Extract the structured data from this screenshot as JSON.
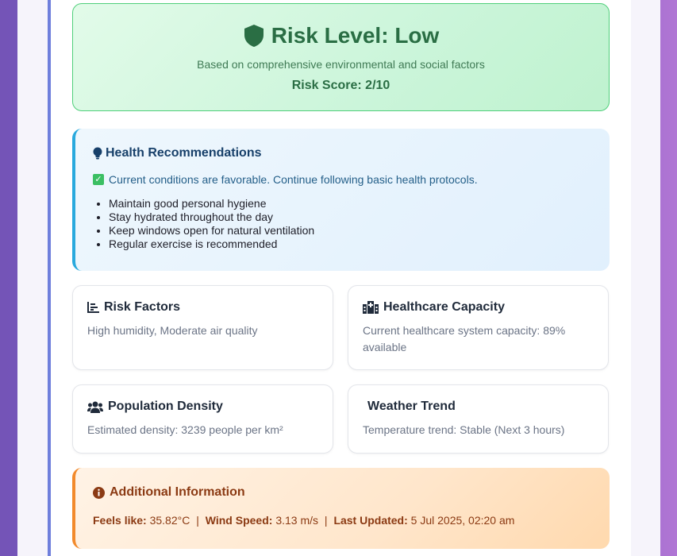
{
  "risk": {
    "title": "Risk Level: Low",
    "subtitle": "Based on comprehensive environmental and social factors",
    "score": "Risk Score: 2/10",
    "icon": "shield-icon"
  },
  "health": {
    "title": "Health Recommendations",
    "note": "Current conditions are favorable. Continue following basic health protocols.",
    "items": [
      "Maintain good personal hygiene",
      "Stay hydrated throughout the day",
      "Keep windows open for natural ventilation",
      "Regular exercise is recommended"
    ]
  },
  "cards": [
    {
      "title": "Risk Factors",
      "text": "High humidity, Moderate air quality",
      "icon": "chart-icon"
    },
    {
      "title": "Healthcare Capacity",
      "text": "Current healthcare system capacity: 89% available",
      "icon": "hospital-icon"
    },
    {
      "title": "Population Density",
      "text": "Estimated density: 3239 people per km²",
      "icon": "users-icon"
    },
    {
      "title": "Weather Trend",
      "text": "Temperature trend: Stable (Next 3 hours)",
      "icon": ""
    }
  ],
  "additional": {
    "title": "Additional Information",
    "feels_label": "Feels like:",
    "feels_value": "35.82°C",
    "wind_label": "Wind Speed:",
    "wind_value": "3.13 m/s",
    "updated_label": "Last Updated:",
    "updated_value": "5 Jul 2025, 02:20 am",
    "separator": "|"
  },
  "colors": {
    "accent": "#6f7fdc",
    "success": "#2a6e44",
    "info": "#29a9dd",
    "warning": "#f28a2c"
  }
}
